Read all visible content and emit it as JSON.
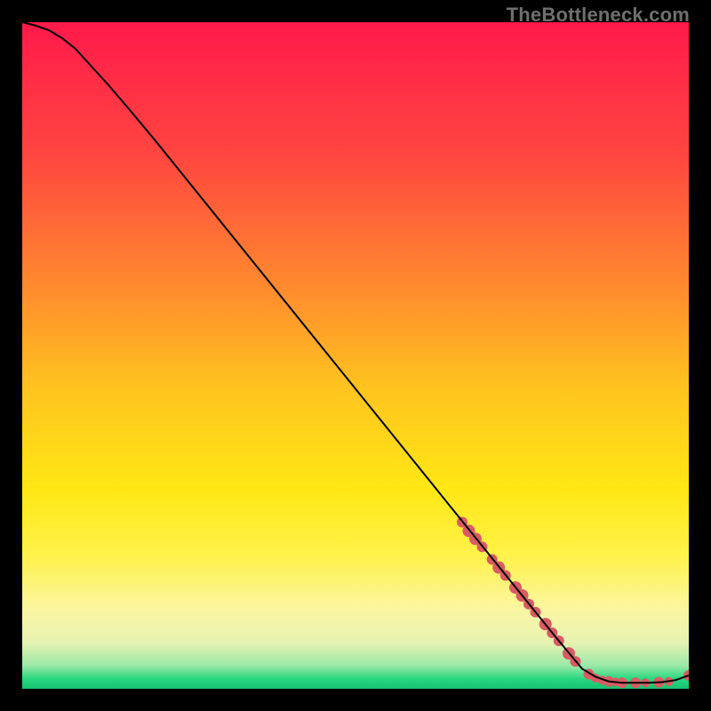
{
  "watermark": "TheBottleneck.com",
  "chart_data": {
    "type": "line",
    "title": "",
    "xlabel": "",
    "ylabel": "",
    "xlim": [
      0,
      100
    ],
    "ylim": [
      0,
      100
    ],
    "grid": false,
    "legend": false,
    "background_gradient": {
      "stops": [
        {
          "offset": 0.0,
          "color": "#ff1a4b"
        },
        {
          "offset": 0.2,
          "color": "#ff4640"
        },
        {
          "offset": 0.4,
          "color": "#ff8b2e"
        },
        {
          "offset": 0.55,
          "color": "#ffc41f"
        },
        {
          "offset": 0.7,
          "color": "#ffe714"
        },
        {
          "offset": 0.8,
          "color": "#fff24a"
        },
        {
          "offset": 0.88,
          "color": "#fbf6a2"
        },
        {
          "offset": 0.93,
          "color": "#e7f3b2"
        },
        {
          "offset": 0.965,
          "color": "#9ce8a8"
        },
        {
          "offset": 0.985,
          "color": "#28d87f"
        },
        {
          "offset": 1.0,
          "color": "#17c26f"
        }
      ]
    },
    "series": [
      {
        "name": "curve",
        "color": "#000000",
        "x": [
          0,
          2,
          4,
          6,
          8,
          10,
          13,
          16,
          20,
          25,
          30,
          35,
          40,
          45,
          50,
          55,
          60,
          65,
          70,
          75,
          80,
          84,
          86,
          88,
          90,
          92,
          94,
          96,
          98,
          100
        ],
        "y": [
          100,
          99.5,
          98.8,
          97.6,
          96.0,
          93.8,
          90.5,
          87.0,
          82.2,
          76.0,
          69.8,
          63.6,
          57.4,
          51.2,
          45.0,
          38.8,
          32.6,
          26.4,
          20.2,
          14.0,
          7.8,
          3.0,
          1.8,
          1.1,
          0.9,
          0.9,
          0.9,
          1.0,
          1.3,
          2.0
        ]
      }
    ],
    "scatter": {
      "name": "highlight-points",
      "color": "#d95b63",
      "points": [
        {
          "x": 66,
          "y": 25.0,
          "r": 6
        },
        {
          "x": 67,
          "y": 23.7,
          "r": 7
        },
        {
          "x": 68,
          "y": 22.5,
          "r": 7
        },
        {
          "x": 69,
          "y": 21.3,
          "r": 6
        },
        {
          "x": 70.5,
          "y": 19.4,
          "r": 6
        },
        {
          "x": 71.5,
          "y": 18.2,
          "r": 7
        },
        {
          "x": 72.5,
          "y": 17.0,
          "r": 6
        },
        {
          "x": 74,
          "y": 15.2,
          "r": 7
        },
        {
          "x": 75,
          "y": 14.0,
          "r": 7
        },
        {
          "x": 76,
          "y": 12.7,
          "r": 6
        },
        {
          "x": 77,
          "y": 11.5,
          "r": 6
        },
        {
          "x": 78.5,
          "y": 9.7,
          "r": 7
        },
        {
          "x": 79.5,
          "y": 8.4,
          "r": 6
        },
        {
          "x": 80.5,
          "y": 7.2,
          "r": 6
        },
        {
          "x": 82,
          "y": 5.3,
          "r": 7
        },
        {
          "x": 83,
          "y": 4.1,
          "r": 6
        },
        {
          "x": 85,
          "y": 2.2,
          "r": 6
        },
        {
          "x": 86,
          "y": 1.6,
          "r": 5
        },
        {
          "x": 87,
          "y": 1.3,
          "r": 5
        },
        {
          "x": 88,
          "y": 1.1,
          "r": 6
        },
        {
          "x": 89,
          "y": 1.0,
          "r": 5
        },
        {
          "x": 90,
          "y": 0.9,
          "r": 6
        },
        {
          "x": 92,
          "y": 0.9,
          "r": 6
        },
        {
          "x": 93.5,
          "y": 0.9,
          "r": 5
        },
        {
          "x": 95.5,
          "y": 1.0,
          "r": 6
        },
        {
          "x": 97,
          "y": 1.1,
          "r": 5
        },
        {
          "x": 100,
          "y": 2.0,
          "r": 6
        }
      ]
    }
  }
}
